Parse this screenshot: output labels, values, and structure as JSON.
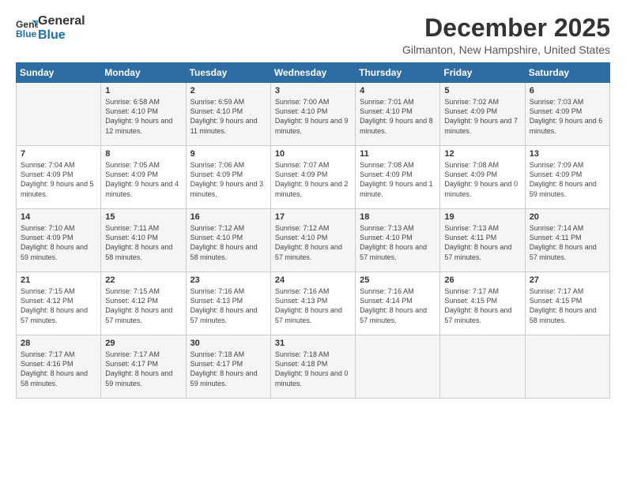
{
  "logo": {
    "line1": "General",
    "line2": "Blue"
  },
  "title": "December 2025",
  "location": "Gilmanton, New Hampshire, United States",
  "weekdays": [
    "Sunday",
    "Monday",
    "Tuesday",
    "Wednesday",
    "Thursday",
    "Friday",
    "Saturday"
  ],
  "weeks": [
    [
      {
        "day": "",
        "sunrise": "",
        "sunset": "",
        "daylight": ""
      },
      {
        "day": "1",
        "sunrise": "Sunrise: 6:58 AM",
        "sunset": "Sunset: 4:10 PM",
        "daylight": "Daylight: 9 hours and 12 minutes."
      },
      {
        "day": "2",
        "sunrise": "Sunrise: 6:59 AM",
        "sunset": "Sunset: 4:10 PM",
        "daylight": "Daylight: 9 hours and 11 minutes."
      },
      {
        "day": "3",
        "sunrise": "Sunrise: 7:00 AM",
        "sunset": "Sunset: 4:10 PM",
        "daylight": "Daylight: 9 hours and 9 minutes."
      },
      {
        "day": "4",
        "sunrise": "Sunrise: 7:01 AM",
        "sunset": "Sunset: 4:10 PM",
        "daylight": "Daylight: 9 hours and 8 minutes."
      },
      {
        "day": "5",
        "sunrise": "Sunrise: 7:02 AM",
        "sunset": "Sunset: 4:09 PM",
        "daylight": "Daylight: 9 hours and 7 minutes."
      },
      {
        "day": "6",
        "sunrise": "Sunrise: 7:03 AM",
        "sunset": "Sunset: 4:09 PM",
        "daylight": "Daylight: 9 hours and 6 minutes."
      }
    ],
    [
      {
        "day": "7",
        "sunrise": "Sunrise: 7:04 AM",
        "sunset": "Sunset: 4:09 PM",
        "daylight": "Daylight: 9 hours and 5 minutes."
      },
      {
        "day": "8",
        "sunrise": "Sunrise: 7:05 AM",
        "sunset": "Sunset: 4:09 PM",
        "daylight": "Daylight: 9 hours and 4 minutes."
      },
      {
        "day": "9",
        "sunrise": "Sunrise: 7:06 AM",
        "sunset": "Sunset: 4:09 PM",
        "daylight": "Daylight: 9 hours and 3 minutes."
      },
      {
        "day": "10",
        "sunrise": "Sunrise: 7:07 AM",
        "sunset": "Sunset: 4:09 PM",
        "daylight": "Daylight: 9 hours and 2 minutes."
      },
      {
        "day": "11",
        "sunrise": "Sunrise: 7:08 AM",
        "sunset": "Sunset: 4:09 PM",
        "daylight": "Daylight: 9 hours and 1 minute."
      },
      {
        "day": "12",
        "sunrise": "Sunrise: 7:08 AM",
        "sunset": "Sunset: 4:09 PM",
        "daylight": "Daylight: 9 hours and 0 minutes."
      },
      {
        "day": "13",
        "sunrise": "Sunrise: 7:09 AM",
        "sunset": "Sunset: 4:09 PM",
        "daylight": "Daylight: 8 hours and 59 minutes."
      }
    ],
    [
      {
        "day": "14",
        "sunrise": "Sunrise: 7:10 AM",
        "sunset": "Sunset: 4:09 PM",
        "daylight": "Daylight: 8 hours and 59 minutes."
      },
      {
        "day": "15",
        "sunrise": "Sunrise: 7:11 AM",
        "sunset": "Sunset: 4:10 PM",
        "daylight": "Daylight: 8 hours and 58 minutes."
      },
      {
        "day": "16",
        "sunrise": "Sunrise: 7:12 AM",
        "sunset": "Sunset: 4:10 PM",
        "daylight": "Daylight: 8 hours and 58 minutes."
      },
      {
        "day": "17",
        "sunrise": "Sunrise: 7:12 AM",
        "sunset": "Sunset: 4:10 PM",
        "daylight": "Daylight: 8 hours and 57 minutes."
      },
      {
        "day": "18",
        "sunrise": "Sunrise: 7:13 AM",
        "sunset": "Sunset: 4:10 PM",
        "daylight": "Daylight: 8 hours and 57 minutes."
      },
      {
        "day": "19",
        "sunrise": "Sunrise: 7:13 AM",
        "sunset": "Sunset: 4:11 PM",
        "daylight": "Daylight: 8 hours and 57 minutes."
      },
      {
        "day": "20",
        "sunrise": "Sunrise: 7:14 AM",
        "sunset": "Sunset: 4:11 PM",
        "daylight": "Daylight: 8 hours and 57 minutes."
      }
    ],
    [
      {
        "day": "21",
        "sunrise": "Sunrise: 7:15 AM",
        "sunset": "Sunset: 4:12 PM",
        "daylight": "Daylight: 8 hours and 57 minutes."
      },
      {
        "day": "22",
        "sunrise": "Sunrise: 7:15 AM",
        "sunset": "Sunset: 4:12 PM",
        "daylight": "Daylight: 8 hours and 57 minutes."
      },
      {
        "day": "23",
        "sunrise": "Sunrise: 7:16 AM",
        "sunset": "Sunset: 4:13 PM",
        "daylight": "Daylight: 8 hours and 57 minutes."
      },
      {
        "day": "24",
        "sunrise": "Sunrise: 7:16 AM",
        "sunset": "Sunset: 4:13 PM",
        "daylight": "Daylight: 8 hours and 57 minutes."
      },
      {
        "day": "25",
        "sunrise": "Sunrise: 7:16 AM",
        "sunset": "Sunset: 4:14 PM",
        "daylight": "Daylight: 8 hours and 57 minutes."
      },
      {
        "day": "26",
        "sunrise": "Sunrise: 7:17 AM",
        "sunset": "Sunset: 4:15 PM",
        "daylight": "Daylight: 8 hours and 57 minutes."
      },
      {
        "day": "27",
        "sunrise": "Sunrise: 7:17 AM",
        "sunset": "Sunset: 4:15 PM",
        "daylight": "Daylight: 8 hours and 58 minutes."
      }
    ],
    [
      {
        "day": "28",
        "sunrise": "Sunrise: 7:17 AM",
        "sunset": "Sunset: 4:16 PM",
        "daylight": "Daylight: 8 hours and 58 minutes."
      },
      {
        "day": "29",
        "sunrise": "Sunrise: 7:17 AM",
        "sunset": "Sunset: 4:17 PM",
        "daylight": "Daylight: 8 hours and 59 minutes."
      },
      {
        "day": "30",
        "sunrise": "Sunrise: 7:18 AM",
        "sunset": "Sunset: 4:17 PM",
        "daylight": "Daylight: 8 hours and 59 minutes."
      },
      {
        "day": "31",
        "sunrise": "Sunrise: 7:18 AM",
        "sunset": "Sunset: 4:18 PM",
        "daylight": "Daylight: 9 hours and 0 minutes."
      },
      {
        "day": "",
        "sunrise": "",
        "sunset": "",
        "daylight": ""
      },
      {
        "day": "",
        "sunrise": "",
        "sunset": "",
        "daylight": ""
      },
      {
        "day": "",
        "sunrise": "",
        "sunset": "",
        "daylight": ""
      }
    ]
  ]
}
